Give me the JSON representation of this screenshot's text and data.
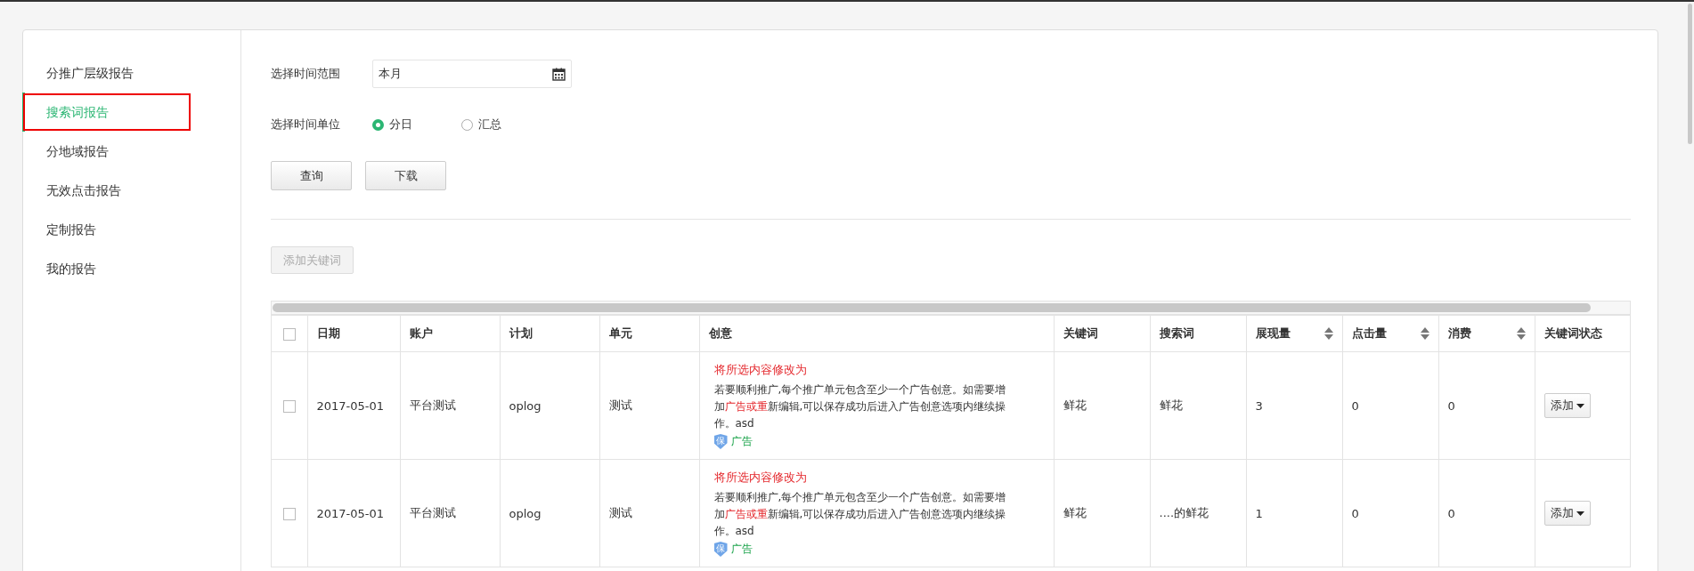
{
  "sidebar": {
    "items": [
      {
        "label": "分推广层级报告",
        "selected": false
      },
      {
        "label": "搜索词报告",
        "selected": true
      },
      {
        "label": "分地域报告",
        "selected": false
      },
      {
        "label": "无效点击报告",
        "selected": false
      },
      {
        "label": "定制报告",
        "selected": false
      },
      {
        "label": "我的报告",
        "selected": false
      }
    ]
  },
  "filters": {
    "time_range": {
      "label": "选择时间范围",
      "value": "本月"
    },
    "time_unit": {
      "label": "选择时间单位",
      "options": [
        {
          "label": "分日",
          "selected": true
        },
        {
          "label": "汇总",
          "selected": false
        }
      ]
    }
  },
  "buttons": [
    {
      "label": "查询"
    },
    {
      "label": "下载"
    }
  ],
  "add_keyword_button": {
    "label": "添加关键词",
    "disabled": true
  },
  "table": {
    "header_checked": false,
    "columns": [
      {
        "label": "日期",
        "sortable": false
      },
      {
        "label": "账户",
        "sortable": false
      },
      {
        "label": "计划",
        "sortable": false
      },
      {
        "label": "单元",
        "sortable": false
      },
      {
        "label": "创意",
        "sortable": false
      },
      {
        "label": "关键词",
        "sortable": false
      },
      {
        "label": "搜索词",
        "sortable": false
      },
      {
        "label": "展现量",
        "sortable": true
      },
      {
        "label": "点击量",
        "sortable": true
      },
      {
        "label": "消费",
        "sortable": true
      },
      {
        "label": "关键词状态",
        "sortable": false
      }
    ],
    "rows": [
      {
        "checked": false,
        "date": "2017-05-01",
        "account": "平台测试",
        "plan": "oplog",
        "unit": "测试",
        "creative": {
          "title": "将所选内容修改为",
          "body_before": "若要顺利推广,每个推广单元包含至少一个广告创意。如需要增加",
          "body_highlight": "广告或重",
          "body_after": "新编辑,可以保存成功后进入广告创意选项内继续操作。asd",
          "badge_icon": "保",
          "badge": "广告"
        },
        "keyword": "鲜花",
        "search_term": "鲜花",
        "impressions": "3",
        "clicks": "0",
        "cost": "0",
        "status_button": "添加"
      },
      {
        "checked": false,
        "date": "2017-05-01",
        "account": "平台测试",
        "plan": "oplog",
        "unit": "测试",
        "creative": {
          "title": "将所选内容修改为",
          "body_before": "若要顺利推广,每个推广单元包含至少一个广告创意。如需要增加",
          "body_highlight": "广告或重",
          "body_after": "新编辑,可以保存成功后进入广告创意选项内继续操作。asd",
          "badge_icon": "保",
          "badge": "广告"
        },
        "keyword": "鲜花",
        "search_term": "....的鲜花",
        "impressions": "1",
        "clicks": "0",
        "cost": "0",
        "status_button": "添加"
      }
    ]
  }
}
